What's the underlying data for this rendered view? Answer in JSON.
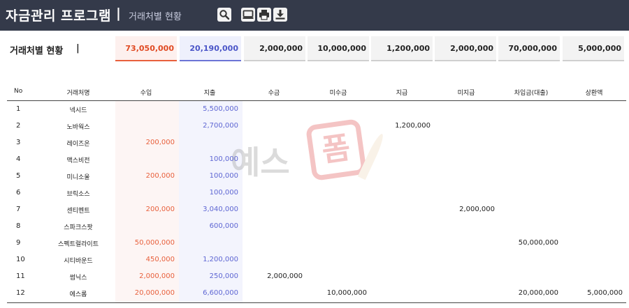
{
  "header": {
    "app_title": "자금관리 프로그램",
    "separator": "|",
    "sub_title": "거래처별 현황",
    "buttons": {
      "search": "search-icon",
      "monitor": "monitor-icon",
      "print": "print-icon",
      "download": "download-icon"
    }
  },
  "summary": {
    "label": "거래처별 현황",
    "separator": "|",
    "income": "73,050,000",
    "expense": "20,190,000",
    "receipts": "2,000,000",
    "unreceived": "10,000,000",
    "payments": "1,200,000",
    "unpaid": "2,000,000",
    "loans": "70,000,000",
    "repayments": "5,000,000"
  },
  "table": {
    "columns": [
      "No",
      "거래처명",
      "수입",
      "지출",
      "수금",
      "미수금",
      "지급",
      "미지급",
      "차입금(대출)",
      "상환액"
    ],
    "rows": [
      {
        "no": "1",
        "name": "넥시드",
        "income": "",
        "expense": "5,500,000",
        "rev": "",
        "unrev": "",
        "pay": "",
        "unpay": "",
        "loan": "",
        "repay": ""
      },
      {
        "no": "2",
        "name": "노바웍스",
        "income": "",
        "expense": "2,700,000",
        "rev": "",
        "unrev": "",
        "pay": "1,200,000",
        "unpay": "",
        "loan": "",
        "repay": ""
      },
      {
        "no": "3",
        "name": "레이즈온",
        "income": "200,000",
        "expense": "",
        "rev": "",
        "unrev": "",
        "pay": "",
        "unpay": "",
        "loan": "",
        "repay": ""
      },
      {
        "no": "4",
        "name": "맥스비전",
        "income": "",
        "expense": "100,000",
        "rev": "",
        "unrev": "",
        "pay": "",
        "unpay": "",
        "loan": "",
        "repay": ""
      },
      {
        "no": "5",
        "name": "미니소울",
        "income": "200,000",
        "expense": "100,000",
        "rev": "",
        "unrev": "",
        "pay": "",
        "unpay": "",
        "loan": "",
        "repay": ""
      },
      {
        "no": "6",
        "name": "브릭소스",
        "income": "",
        "expense": "100,000",
        "rev": "",
        "unrev": "",
        "pay": "",
        "unpay": "",
        "loan": "",
        "repay": ""
      },
      {
        "no": "7",
        "name": "센티멘트",
        "income": "200,000",
        "expense": "3,040,000",
        "rev": "",
        "unrev": "",
        "pay": "",
        "unpay": "2,000,000",
        "loan": "",
        "repay": ""
      },
      {
        "no": "8",
        "name": "스파크스팟",
        "income": "",
        "expense": "600,000",
        "rev": "",
        "unrev": "",
        "pay": "",
        "unpay": "",
        "loan": "",
        "repay": ""
      },
      {
        "no": "9",
        "name": "스펙트럴라이트",
        "income": "50,000,000",
        "expense": "",
        "rev": "",
        "unrev": "",
        "pay": "",
        "unpay": "",
        "loan": "50,000,000",
        "repay": ""
      },
      {
        "no": "10",
        "name": "시티바운드",
        "income": "450,000",
        "expense": "1,200,000",
        "rev": "",
        "unrev": "",
        "pay": "",
        "unpay": "",
        "loan": "",
        "repay": ""
      },
      {
        "no": "11",
        "name": "썸닉스",
        "income": "2,000,000",
        "expense": "250,000",
        "rev": "2,000,000",
        "unrev": "",
        "pay": "",
        "unpay": "",
        "loan": "",
        "repay": ""
      },
      {
        "no": "12",
        "name": "에스롬",
        "income": "20,000,000",
        "expense": "6,600,000",
        "rev": "",
        "unrev": "10,000,000",
        "pay": "",
        "unpay": "",
        "loan": "20,000,000",
        "repay": "5,000,000"
      }
    ]
  },
  "watermark": {
    "text": "예스",
    "badge": "폼"
  },
  "colors": {
    "header_bg": "#343a4a",
    "income": "#e8603c",
    "expense": "#5e66d3"
  }
}
